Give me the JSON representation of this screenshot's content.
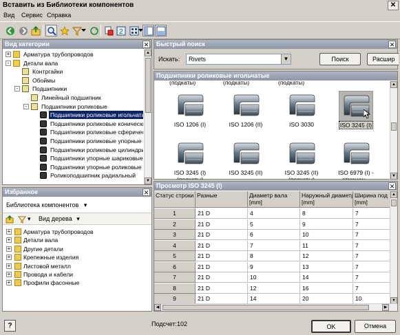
{
  "window": {
    "title": "Вставить из Библиотеки компонентов",
    "close": "✕"
  },
  "menu": [
    "Вид",
    "Сервис",
    "Справка"
  ],
  "category_panel": {
    "title": "Вид категории",
    "items": [
      {
        "label": "Арматура трубопроводов",
        "level": 0,
        "pm": "+",
        "icon": "folder"
      },
      {
        "label": "Детали вала",
        "level": 0,
        "pm": "-",
        "icon": "folder"
      },
      {
        "label": "Контргайки",
        "level": 1,
        "pm": "",
        "icon": "grp"
      },
      {
        "label": "Обоймы",
        "level": 1,
        "pm": "",
        "icon": "grp"
      },
      {
        "label": "Подшипники",
        "level": 1,
        "pm": "-",
        "icon": "grp"
      },
      {
        "label": "Линейный подшипник",
        "level": 2,
        "pm": "",
        "icon": "grp"
      },
      {
        "label": "Подшипники роликовые",
        "level": 2,
        "pm": "-",
        "icon": "grp"
      },
      {
        "label": "Подшипники роликовые игольчатые",
        "level": 3,
        "pm": "",
        "icon": "bear",
        "selected": true
      },
      {
        "label": "Подшипники роликовые конические",
        "level": 3,
        "pm": "",
        "icon": "bear"
      },
      {
        "label": "Подшипники роликовые сферические",
        "level": 3,
        "pm": "",
        "icon": "bear"
      },
      {
        "label": "Подшипники роликовые упорные",
        "level": 3,
        "pm": "",
        "icon": "bear"
      },
      {
        "label": "Подшипники роликовые цилиндрические",
        "level": 3,
        "pm": "",
        "icon": "bear"
      },
      {
        "label": "Подшипники упорные шариковые",
        "level": 3,
        "pm": "",
        "icon": "bear"
      },
      {
        "label": "Подшипники упорные роликовые",
        "level": 3,
        "pm": "",
        "icon": "bear"
      },
      {
        "label": "Роликоподшипник радиальный",
        "level": 3,
        "pm": "",
        "icon": "bear"
      }
    ]
  },
  "favorites_panel": {
    "title": "Избранное",
    "library_label": "Библиотека компонентов",
    "view_label": "Вид дерева",
    "items": [
      {
        "label": "Арматура трубопроводов",
        "icon": "folder"
      },
      {
        "label": "Детали вала",
        "icon": "folder"
      },
      {
        "label": "Другие детали",
        "icon": "folder"
      },
      {
        "label": "Крепежные изделия",
        "icon": "folder"
      },
      {
        "label": "Листовой металл",
        "icon": "folder"
      },
      {
        "label": "Провода и кабели",
        "icon": "folder"
      },
      {
        "label": "Профили фасонные",
        "icon": "folder"
      }
    ]
  },
  "quick_search": {
    "title": "Быстрый поиск",
    "search_label": "Искать:",
    "search_value": "Rivets",
    "search_button": "Поиск",
    "advanced_button": "Расшир"
  },
  "thumbnails": {
    "title": "Подшипники роликовые игольчатые",
    "top_labels": [
      "(подкаты)",
      "(подкаты)",
      "(подкаты)"
    ],
    "items": [
      {
        "label1": "ISO 1206 (I)",
        "label2": ""
      },
      {
        "label1": "ISO 1206 (II)",
        "label2": ""
      },
      {
        "label1": "ISO 3030",
        "label2": ""
      },
      {
        "label1": "ISO 3245 (I)",
        "label2": "",
        "selected": true
      },
      {
        "label1": "ISO 3245 (I)",
        "label2": "(подкаты)"
      },
      {
        "label1": "ISO 3245 (II)",
        "label2": ""
      },
      {
        "label1": "ISO 3245 (II)",
        "label2": "(подкаты)"
      },
      {
        "label1": "ISO 6979 (I) -",
        "label2": "отменен..."
      }
    ]
  },
  "table": {
    "title": "Просмотр ISO 3245 (I)",
    "headers": [
      "Статус строки",
      "Разные",
      "Диаметр вала [mm]",
      "Наружный диаметр [mm]",
      "Ширина под"
    ],
    "header_line1": [
      "Статус строки",
      "Разные",
      "Диаметр вала",
      "Наружный диаметр",
      "Ширина под"
    ],
    "header_line2": [
      "",
      "",
      "[mm]",
      "[mm]",
      "[mm]"
    ],
    "rows": [
      [
        "1",
        "21 D",
        "4",
        "8",
        "7"
      ],
      [
        "2",
        "21 D",
        "5",
        "9",
        "7"
      ],
      [
        "3",
        "21 D",
        "6",
        "10",
        "7"
      ],
      [
        "4",
        "21 D",
        "7",
        "11",
        "7"
      ],
      [
        "5",
        "21 D",
        "8",
        "12",
        "7"
      ],
      [
        "6",
        "21 D",
        "9",
        "13",
        "7"
      ],
      [
        "7",
        "21 D",
        "10",
        "14",
        "7"
      ],
      [
        "8",
        "21 D",
        "12",
        "16",
        "7"
      ],
      [
        "9",
        "21 D",
        "14",
        "20",
        "10"
      ]
    ]
  },
  "status": {
    "count": "Подсчет:102"
  },
  "buttons": {
    "ok": "OK",
    "cancel": "Отмена",
    "help": "?"
  }
}
